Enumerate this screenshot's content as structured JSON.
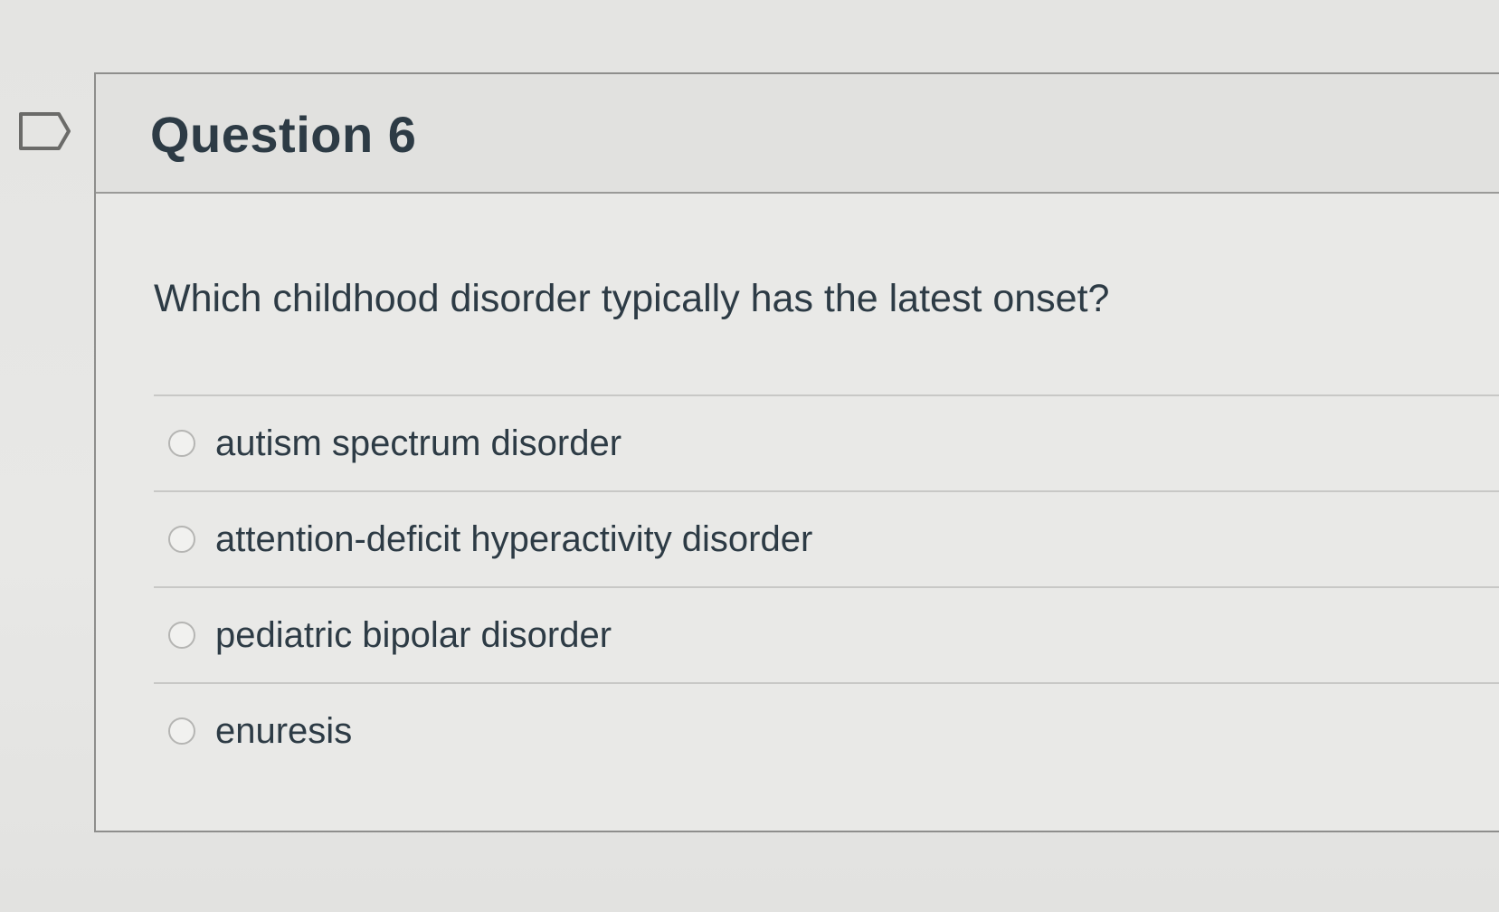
{
  "question": {
    "title": "Question 6",
    "text": "Which childhood disorder typically has the latest onset?",
    "flag_icon": "flag-outline-icon",
    "answers": [
      {
        "label": "autism spectrum disorder",
        "selected": false
      },
      {
        "label": "attention-deficit hyperactivity disorder",
        "selected": false
      },
      {
        "label": "pediatric bipolar disorder",
        "selected": false
      },
      {
        "label": "enuresis",
        "selected": false
      }
    ]
  },
  "colors": {
    "text": "#2d3b45",
    "border": "#8e8e8c",
    "background": "#e6e6e4"
  }
}
